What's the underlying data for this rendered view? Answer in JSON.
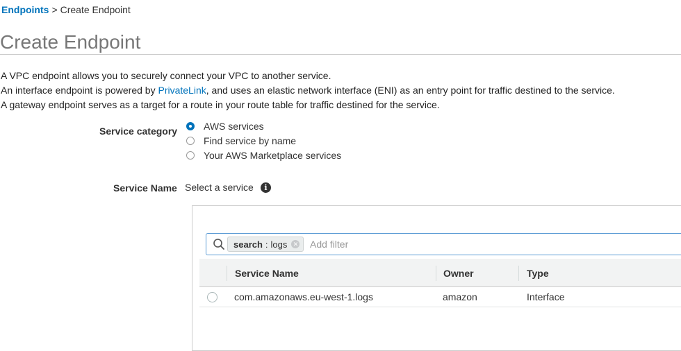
{
  "breadcrumb": {
    "parent": "Endpoints",
    "separator": ">",
    "current": "Create Endpoint"
  },
  "page_title": "Create Endpoint",
  "description": {
    "line1": "A VPC endpoint allows you to securely connect your VPC to another service.",
    "line2_prefix": "An interface endpoint is powered by",
    "line2_link": "PrivateLink",
    "line2_suffix": ", and uses an elastic network interface (ENI) as an entry point for traffic destined to the service.",
    "line3": "A gateway endpoint serves as a target for a route in your route table for traffic destined for the service."
  },
  "service_category": {
    "label": "Service category",
    "options": [
      {
        "label": "AWS services",
        "selected": true
      },
      {
        "label": "Find service by name",
        "selected": false
      },
      {
        "label": "Your AWS Marketplace services",
        "selected": false
      }
    ]
  },
  "service_name": {
    "label": "Service Name",
    "value_text": "Select a service",
    "info_icon": "info-icon"
  },
  "filter": {
    "token_key": "search",
    "token_separator": ":",
    "token_value": "logs",
    "placeholder": "Add filter",
    "icon": "search-icon"
  },
  "table": {
    "columns": [
      "Service Name",
      "Owner",
      "Type"
    ],
    "rows": [
      {
        "service_name": "com.amazonaws.eu-west-1.logs",
        "owner": "amazon",
        "type": "Interface",
        "selected": false
      }
    ]
  },
  "colors": {
    "link": "#0073bb",
    "title": "#777777",
    "header_bg": "#f2f3f3",
    "filter_border": "#5b9bd5"
  }
}
